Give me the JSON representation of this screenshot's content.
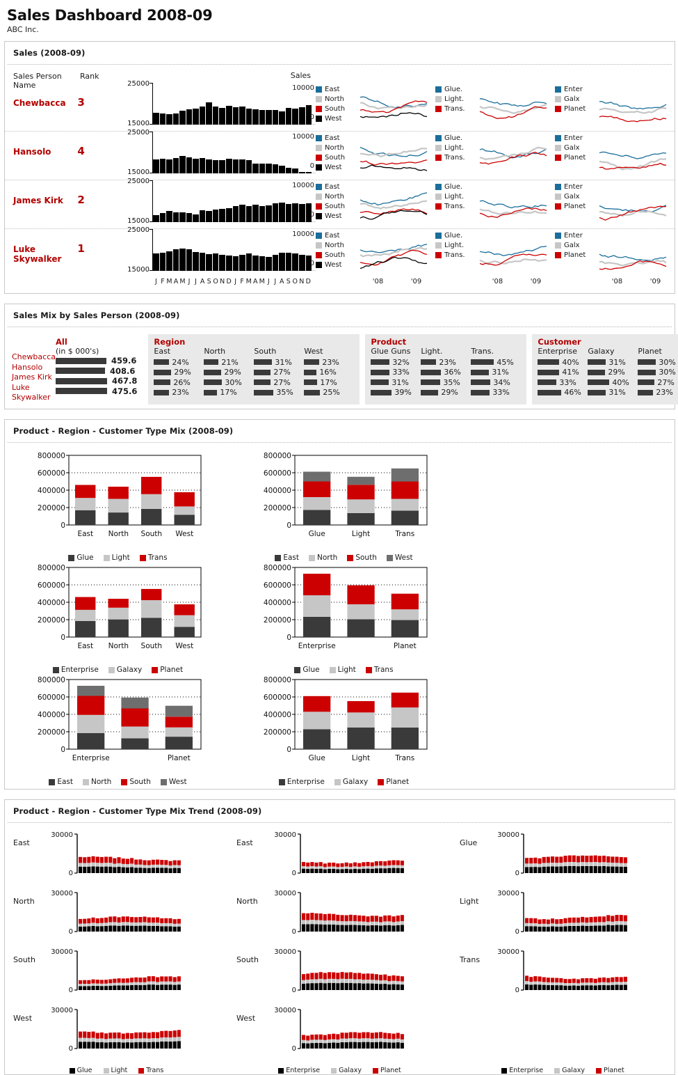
{
  "header": {
    "title": "Sales Dashboard 2008-09",
    "subtitle": "ABC Inc."
  },
  "colors": {
    "red": "#cc0000",
    "dark_red_text": "#b20000",
    "blue": "#1a6e9b",
    "light_gray": "#c6c6c6",
    "dark_gray": "#3a3a3a",
    "mid_gray": "#6e6e6e",
    "black": "#000000"
  },
  "sales_panel": {
    "title": "Sales (2008-09)",
    "col_name_header": "Sales Person Name",
    "col_rank_header": "Rank",
    "sales_label": "Sales",
    "y_top": "25000",
    "y_bottom": "15000",
    "spark_y_top": "10000",
    "spark_y_bottom": "0",
    "months": [
      "J",
      "F",
      "M",
      "A",
      "M",
      "J",
      "J",
      "A",
      "S",
      "O",
      "N",
      "D",
      "J",
      "F",
      "M",
      "A",
      "M",
      "J",
      "J",
      "A",
      "S",
      "O",
      "N",
      "D"
    ],
    "year_labels": [
      "'08",
      "'09"
    ],
    "legend_groups": [
      {
        "name": "region",
        "items": [
          {
            "label": "East",
            "color": "#1a6e9b"
          },
          {
            "label": "North",
            "color": "#c6c6c6"
          },
          {
            "label": "South",
            "color": "#cc0000"
          },
          {
            "label": "West",
            "color": "#000000"
          }
        ]
      },
      {
        "name": "product",
        "items": [
          {
            "label": "Glue.",
            "color": "#1a6e9b"
          },
          {
            "label": "Light.",
            "color": "#c6c6c6"
          },
          {
            "label": "Trans.",
            "color": "#cc0000"
          }
        ]
      },
      {
        "name": "customer",
        "items": [
          {
            "label": "Enter",
            "color": "#1a6e9b"
          },
          {
            "label": "Galx",
            "color": "#c6c6c6"
          },
          {
            "label": "Planet",
            "color": "#cc0000"
          }
        ]
      }
    ],
    "people": [
      {
        "name": "Chewbacca",
        "rank": "3"
      },
      {
        "name": "Hansolo",
        "rank": "4"
      },
      {
        "name": "James Kirk",
        "rank": "2"
      },
      {
        "name": "Luke Skywalker",
        "rank": "1"
      }
    ]
  },
  "sales_mix": {
    "title": "Sales Mix by Sales Person (2008-09)",
    "people": [
      "Chewbacca",
      "Hansolo",
      "James Kirk",
      "Luke Skywalker"
    ],
    "all": {
      "header": "All",
      "sub": "(in $ 000's)",
      "values": [
        "459.6",
        "408.6",
        "467.8",
        "475.6"
      ]
    },
    "groups": [
      {
        "header": "Region",
        "cols": [
          {
            "label": "East",
            "values": [
              "24%",
              "29%",
              "26%",
              "23%"
            ]
          },
          {
            "label": "North",
            "values": [
              "21%",
              "29%",
              "30%",
              "17%"
            ]
          },
          {
            "label": "South",
            "values": [
              "31%",
              "27%",
              "27%",
              "35%"
            ]
          },
          {
            "label": "West",
            "values": [
              "23%",
              "16%",
              "17%",
              "25%"
            ]
          }
        ]
      },
      {
        "header": "Product",
        "cols": [
          {
            "label": "Glue Guns",
            "values": [
              "32%",
              "33%",
              "31%",
              "39%"
            ]
          },
          {
            "label": "Light.",
            "values": [
              "23%",
              "36%",
              "35%",
              "29%"
            ]
          },
          {
            "label": "Trans.",
            "values": [
              "45%",
              "31%",
              "34%",
              "33%"
            ]
          }
        ]
      },
      {
        "header": "Customer",
        "cols": [
          {
            "label": "Enterprise",
            "values": [
              "40%",
              "41%",
              "33%",
              "46%"
            ]
          },
          {
            "label": "Galaxy",
            "values": [
              "31%",
              "29%",
              "40%",
              "31%"
            ]
          },
          {
            "label": "Planet",
            "values": [
              "30%",
              "30%",
              "27%",
              "23%"
            ]
          }
        ]
      }
    ]
  },
  "mix_panel": {
    "title": "Product - Region - Customer Type Mix (2008-09)",
    "y_ticks": [
      "800000",
      "600000",
      "400000",
      "200000",
      "0"
    ],
    "charts": [
      {
        "type": "bar",
        "stacked": true,
        "categories": [
          "East",
          "North",
          "South",
          "West"
        ],
        "series": [
          {
            "name": "Glue",
            "color": "#3a3a3a",
            "values": [
              170000,
              143000,
              185000,
              118000
            ]
          },
          {
            "name": "Light",
            "color": "#c6c6c6",
            "values": [
              140000,
              157000,
              170000,
              95000
            ]
          },
          {
            "name": "Trans",
            "color": "#cc0000",
            "values": [
              150000,
              140000,
              198000,
              163000
            ]
          }
        ],
        "ylim": [
          0,
          800000
        ]
      },
      {
        "type": "bar",
        "stacked": true,
        "categories": [
          "Glue",
          "Light",
          "Trans"
        ],
        "series": [
          {
            "name": "East",
            "color": "#3a3a3a",
            "values": [
              172000,
              137000,
              165000
            ]
          },
          {
            "name": "North",
            "color": "#c6c6c6",
            "values": [
              148000,
              157000,
              135000
            ]
          },
          {
            "name": "South",
            "color": "#cc0000",
            "values": [
              180000,
              168000,
              200000
            ]
          },
          {
            "name": "West",
            "color": "#6e6e6e",
            "values": [
              112000,
              92000,
              150000
            ]
          }
        ],
        "ylim": [
          0,
          800000
        ]
      },
      {
        "type": "bar",
        "stacked": true,
        "categories": [
          "East",
          "North",
          "South",
          "West"
        ],
        "series": [
          {
            "name": "Enterprise",
            "color": "#3a3a3a",
            "values": [
              185000,
              203000,
              222000,
              118000
            ]
          },
          {
            "name": "Galaxy",
            "color": "#c6c6c6",
            "values": [
              128000,
              135000,
              202000,
              133000
            ]
          },
          {
            "name": "Planet",
            "color": "#cc0000",
            "values": [
              147000,
              102000,
              129000,
              125000
            ]
          }
        ],
        "ylim": [
          0,
          800000
        ]
      },
      {
        "type": "bar",
        "stacked": true,
        "categories": [
          "Enterprise",
          "",
          "Planet"
        ],
        "series": [
          {
            "name": "Glue",
            "color": "#3a3a3a",
            "values": [
              232000,
              205000,
              196000
            ]
          },
          {
            "name": "Light",
            "color": "#c6c6c6",
            "values": [
              248000,
              172000,
              122000
            ]
          },
          {
            "name": "Trans",
            "color": "#cc0000",
            "values": [
              248000,
              218000,
              180000
            ]
          }
        ],
        "ylim": [
          0,
          800000
        ]
      },
      {
        "type": "bar",
        "stacked": true,
        "categories": [
          "Enterprise",
          "",
          "Planet"
        ],
        "series": [
          {
            "name": "East",
            "color": "#3a3a3a",
            "values": [
              186000,
              125000,
              143000
            ]
          },
          {
            "name": "North",
            "color": "#c6c6c6",
            "values": [
              208000,
              135000,
              108000
            ]
          },
          {
            "name": "South",
            "color": "#cc0000",
            "values": [
              218000,
              208000,
              122000
            ]
          },
          {
            "name": "West",
            "color": "#6e6e6e",
            "values": [
              116000,
              125000,
              125000
            ]
          }
        ],
        "ylim": [
          0,
          800000
        ]
      },
      {
        "type": "bar",
        "stacked": true,
        "categories": [
          "Glue",
          "Light",
          "Trans"
        ],
        "series": [
          {
            "name": "Enterprise",
            "color": "#3a3a3a",
            "values": [
              230000,
              250000,
              248000
            ]
          },
          {
            "name": "Galaxy",
            "color": "#c6c6c6",
            "values": [
              200000,
              172000,
              232000
            ]
          },
          {
            "name": "Planet",
            "color": "#cc0000",
            "values": [
              180000,
              130000,
              170000
            ]
          }
        ],
        "ylim": [
          0,
          800000
        ]
      }
    ],
    "legends": [
      [
        {
          "label": "Glue",
          "color": "#3a3a3a"
        },
        {
          "label": "Light",
          "color": "#c6c6c6"
        },
        {
          "label": "Trans",
          "color": "#cc0000"
        }
      ],
      [
        {
          "label": "East",
          "color": "#3a3a3a"
        },
        {
          "label": "North",
          "color": "#c6c6c6"
        },
        {
          "label": "South",
          "color": "#cc0000"
        },
        {
          "label": "West",
          "color": "#6e6e6e"
        }
      ],
      [
        {
          "label": "Enterprise",
          "color": "#3a3a3a"
        },
        {
          "label": "Galaxy",
          "color": "#c6c6c6"
        },
        {
          "label": "Planet",
          "color": "#cc0000"
        }
      ],
      [
        {
          "label": "Glue",
          "color": "#3a3a3a"
        },
        {
          "label": "Light",
          "color": "#c6c6c6"
        },
        {
          "label": "Trans",
          "color": "#cc0000"
        }
      ],
      [
        {
          "label": "East",
          "color": "#3a3a3a"
        },
        {
          "label": "North",
          "color": "#c6c6c6"
        },
        {
          "label": "South",
          "color": "#cc0000"
        },
        {
          "label": "West",
          "color": "#6e6e6e"
        }
      ],
      [
        {
          "label": "Enterprise",
          "color": "#3a3a3a"
        },
        {
          "label": "Galaxy",
          "color": "#c6c6c6"
        },
        {
          "label": "Planet",
          "color": "#cc0000"
        }
      ]
    ]
  },
  "trend_panel": {
    "title": "Product - Region - Customer Type Mix Trend  (2008-09)",
    "y_top": "30000",
    "y_bottom": "0",
    "columns": [
      {
        "row_labels": [
          "East",
          "North",
          "South",
          "West"
        ],
        "legend": [
          {
            "label": "Glue",
            "color": "#000000"
          },
          {
            "label": "Light",
            "color": "#c6c6c6"
          },
          {
            "label": "Trans",
            "color": "#cc0000"
          }
        ]
      },
      {
        "row_labels": [
          "East",
          "North",
          "South",
          "West"
        ],
        "legend": [
          {
            "label": "Enterprise",
            "color": "#000000"
          },
          {
            "label": "Galaxy",
            "color": "#c6c6c6"
          },
          {
            "label": "Planet",
            "color": "#cc0000"
          }
        ]
      },
      {
        "row_labels": [
          "Glue",
          "Light",
          "Trans"
        ],
        "legend": [
          {
            "label": "Enterprise",
            "color": "#000000"
          },
          {
            "label": "Galaxy",
            "color": "#c6c6c6"
          },
          {
            "label": "Planet",
            "color": "#cc0000"
          }
        ]
      }
    ]
  },
  "chart_data": {
    "type": "bar",
    "title": "Sales Dashboard 2008-09",
    "sales_trend": {
      "type": "bar",
      "ylabel": "Sales",
      "ylim": [
        15000,
        25000
      ],
      "categories": [
        "J",
        "F",
        "M",
        "A",
        "M",
        "J",
        "J",
        "A",
        "S",
        "O",
        "N",
        "D",
        "J",
        "F",
        "M",
        "A",
        "M",
        "J",
        "J",
        "A",
        "S",
        "O",
        "N",
        "D"
      ],
      "series": [
        {
          "name": "Chewbacca",
          "values": [
            17800,
            17600,
            17500,
            17600,
            18300,
            18600,
            18900,
            19300,
            20300,
            19400,
            19000,
            19500,
            19200,
            19400,
            18900,
            18700,
            18500,
            18500,
            18500,
            18100,
            19000,
            18900,
            19200,
            19600
          ]
        },
        {
          "name": "Hansolo",
          "values": [
            18400,
            18500,
            18300,
            18600,
            19200,
            18900,
            18500,
            18700,
            18400,
            18200,
            18100,
            18500,
            18300,
            18300,
            18100,
            17400,
            17300,
            17300,
            17200,
            16900,
            16300,
            16100,
            15400,
            15300
          ]
        },
        {
          "name": "James Kirk",
          "values": [
            16700,
            17200,
            17700,
            17300,
            17300,
            17200,
            16900,
            17800,
            17700,
            18000,
            18100,
            18300,
            18800,
            19200,
            18900,
            19100,
            18800,
            19000,
            19500,
            19600,
            19300,
            19500,
            19400,
            19500
          ]
        },
        {
          "name": "Luke Skywalker",
          "values": [
            19200,
            19400,
            19600,
            20200,
            20300,
            20100,
            19500,
            19300,
            19000,
            19100,
            18900,
            18700,
            18500,
            18800,
            19100,
            18600,
            18500,
            18300,
            18800,
            19400,
            19300,
            19100,
            18800,
            18600
          ]
        }
      ]
    },
    "sales_mix": {
      "type": "table",
      "rows": [
        "Chewbacca",
        "Hansolo",
        "James Kirk",
        "Luke Skywalker"
      ],
      "all_total_k": [
        459.6,
        408.6,
        467.8,
        475.6
      ],
      "region": {
        "East": [
          24,
          29,
          26,
          23
        ],
        "North": [
          21,
          29,
          30,
          17
        ],
        "South": [
          31,
          27,
          27,
          35
        ],
        "West": [
          23,
          16,
          17,
          25
        ]
      },
      "product": {
        "Glue Guns": [
          32,
          33,
          31,
          39
        ],
        "Light.": [
          23,
          36,
          35,
          29
        ],
        "Trans.": [
          45,
          31,
          34,
          33
        ]
      },
      "customer": {
        "Enterprise": [
          40,
          41,
          33,
          46
        ],
        "Galaxy": [
          31,
          29,
          40,
          31
        ],
        "Planet": [
          30,
          30,
          27,
          23
        ]
      }
    },
    "trend_small_multiples": {
      "type": "bar",
      "stacked": true,
      "ylim": [
        0,
        30000
      ],
      "n_periods": 24,
      "note": "Three columns of stacked monthly bars: Product mix by Region, Customer mix by Region, Customer mix by Product"
    }
  }
}
